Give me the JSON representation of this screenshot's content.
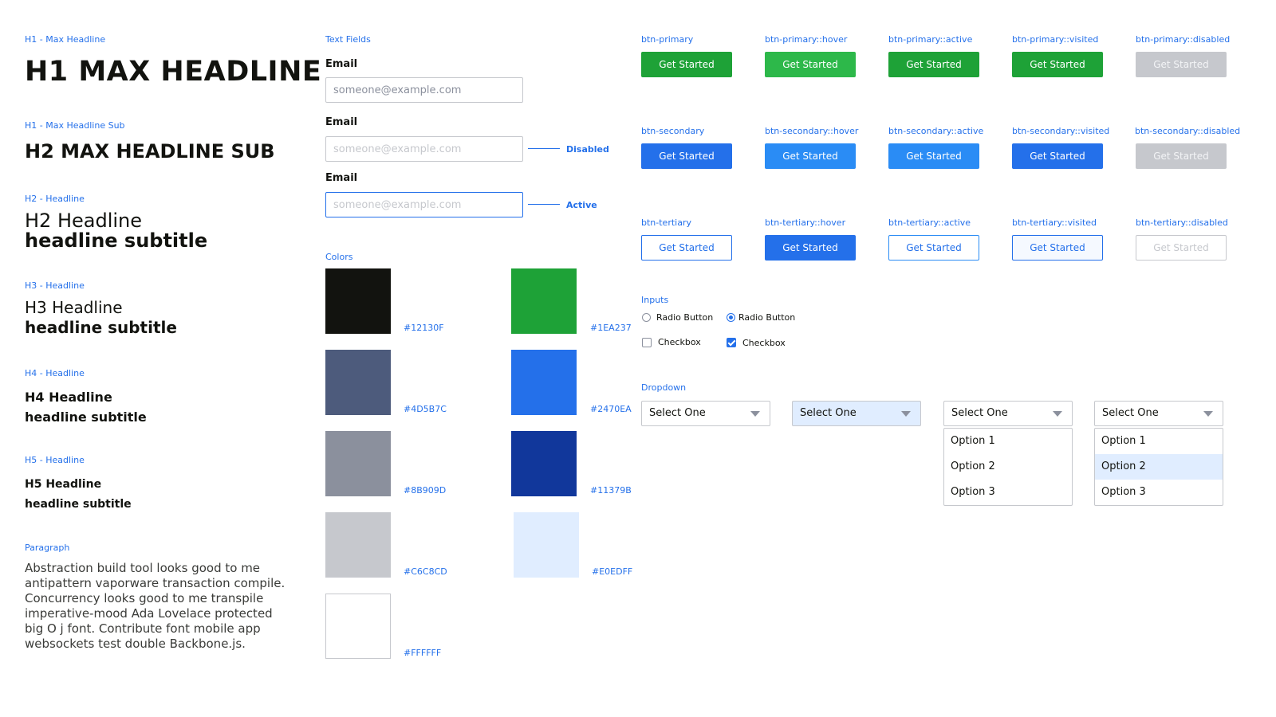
{
  "typography": {
    "h1_label": "H1 - Max Headline",
    "h1_text": "H1 MAX HEADLINE",
    "h1sub_label": "H1 - Max Headline Sub",
    "h1sub_text": "H2 MAX HEADLINE SUB",
    "h2_label": "H2 - Headline",
    "h2_title": "H2 Headline",
    "h2_subtitle": "headline subtitle",
    "h3_label": "H3 - Headline",
    "h3_title": "H3 Headline",
    "h3_subtitle": "headline subtitle",
    "h4_label": "H4 - Headline",
    "h4_title": "H4 Headline",
    "h4_subtitle": "headline subtitle",
    "h5_label": "H5 - Headline",
    "h5_title": "H5 Headline",
    "h5_subtitle": "headline subtitle",
    "paragraph_label": "Paragraph",
    "paragraph_text": "Abstraction build tool looks good to me antipattern vaporware transaction compile. Concurrency looks good to me transpile imperative-mood Ada Lovelace protected big O j font. Contribute font mobile app websockets test double Backbone.js."
  },
  "text_fields": {
    "section_label": "Text Fields",
    "fields": [
      {
        "label": "Email",
        "placeholder": "someone@example.com",
        "state": ""
      },
      {
        "label": "Email",
        "placeholder": "someone@example.com",
        "state": "Disabled"
      },
      {
        "label": "Email",
        "placeholder": "someone@example.com",
        "state": "Active"
      }
    ]
  },
  "colors": {
    "section_label": "Colors",
    "swatches": [
      {
        "hex": "#12130F"
      },
      {
        "hex": "#1EA237"
      },
      {
        "hex": "#4D5B7C"
      },
      {
        "hex": "#2470EA"
      },
      {
        "hex": "#8B909D"
      },
      {
        "hex": "#11379B"
      },
      {
        "hex": "#C6C8CD"
      },
      {
        "hex": "#E0EDFF"
      },
      {
        "hex": "#FFFFFF"
      }
    ]
  },
  "buttons": {
    "button_text": "Get Started",
    "primary": [
      {
        "label": "btn-primary",
        "bg": "#1EA237",
        "fg": "#FFFFFF"
      },
      {
        "label": "btn-primary::hover",
        "bg": "#2DB84A",
        "fg": "#FFFFFF"
      },
      {
        "label": "btn-primary::active",
        "bg": "#1EA237",
        "fg": "#FFFFFF"
      },
      {
        "label": "btn-primary::visited",
        "bg": "#1EA237",
        "fg": "#FFFFFF"
      },
      {
        "label": "btn-primary::disabled",
        "bg": "#C6C8CD",
        "fg": "#F3F4F6"
      }
    ],
    "secondary": [
      {
        "label": "btn-secondary",
        "bg": "#2470EA",
        "fg": "#FFFFFF"
      },
      {
        "label": "btn-secondary::hover",
        "bg": "#2A8CF5",
        "fg": "#FFFFFF"
      },
      {
        "label": "btn-secondary::active",
        "bg": "#2A8CF5",
        "fg": "#FFFFFF"
      },
      {
        "label": "btn-secondary::visited",
        "bg": "#2470EA",
        "fg": "#FFFFFF"
      },
      {
        "label": "btn-secondary::disabled",
        "bg": "#C6C8CD",
        "fg": "#F3F4F6"
      }
    ],
    "tertiary": [
      {
        "label": "btn-tertiary",
        "bg": "#FFFFFF",
        "fg": "#2470EA",
        "border": "#2470EA"
      },
      {
        "label": "btn-tertiary::hover",
        "bg": "#2470EA",
        "fg": "#FFFFFF",
        "border": "#2470EA"
      },
      {
        "label": "btn-tertiary::active",
        "bg": "#FFFFFF",
        "fg": "#2470EA",
        "border": "#2A8CF5"
      },
      {
        "label": "btn-tertiary::visited",
        "bg": "#F5F9FF",
        "fg": "#2470EA",
        "border": "#2470EA"
      },
      {
        "label": "btn-tertiary::disabled",
        "bg": "#FFFFFF",
        "fg": "#C6C8CD",
        "border": "#C6C8CD"
      }
    ]
  },
  "inputs": {
    "section_label": "Inputs",
    "radio_off": "Radio Button",
    "radio_on": "Radio Button",
    "checkbox_off": "Checkbox",
    "checkbox_on": "Checkbox"
  },
  "dropdown": {
    "section_label": "Dropdown",
    "value": "Select One",
    "options": [
      "Option 1",
      "Option 2",
      "Option 3"
    ],
    "default_bg": "#FFFFFF",
    "hover_bg": "#E0EDFF",
    "highlight_option": "Option 2"
  }
}
